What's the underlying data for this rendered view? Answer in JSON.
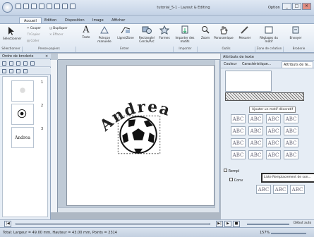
{
  "titlebar": {
    "title": "tutorial_5-1 - Layout & Editing",
    "option_label": "Option",
    "min": "_",
    "max": "□",
    "close": "×"
  },
  "tabs": [
    {
      "label": "Accueil"
    },
    {
      "label": "Edition"
    },
    {
      "label": "Disposition"
    },
    {
      "label": "Image"
    },
    {
      "label": "Afficher"
    }
  ],
  "ribbon": {
    "select": "Sélectionner",
    "clipboard": [
      "Couper",
      "Copier",
      "Coller",
      "Dupliquer",
      "Effacer"
    ],
    "texte": "Texte",
    "poincon": "Poinçon manuelle",
    "ligne": "Ligne/Zone",
    "rectangle": "Rectangle/ Cercle/Arc",
    "formes": "Formes",
    "importer": "Importer des motifs",
    "zoom": "Zoom",
    "panoramique": "Panoramique",
    "mesurer": "Mesurer",
    "reglages": "Réglages du motif",
    "envoyer": "Envoyer",
    "groups": [
      "Sélectionner",
      "Presse-papiers",
      "Entrer",
      "Importer",
      "Outils",
      "Zone de création",
      "Broderie"
    ]
  },
  "leftpanel": {
    "header": "Ordre de broderie",
    "items": [
      {
        "num": "1"
      },
      {
        "num": "2"
      },
      {
        "num": "3"
      }
    ],
    "thumb3_text": "Andrea"
  },
  "canvas": {
    "text": "Andrea"
  },
  "rightpanel": {
    "header": "Attributs de texte",
    "tabs": [
      "Couleur",
      "Caractéristique...",
      "Attributs de te..."
    ],
    "tooltip": "Ajouter un motif décoratif",
    "abc": "ABC",
    "remplissage_label": "Rempl",
    "conv_label": "Conv",
    "highlight_label": "Liste Remplacement de son..."
  },
  "playbar": {
    "buttons": [
      "|◀",
      "◀",
      "▶|",
      "▶",
      "■"
    ],
    "speed_label": "Début auto"
  },
  "status": {
    "text": "Total: Largeur = 49.00 mm, Hauteur = 43.00 mm, Points = 2314",
    "zoom": "157%"
  },
  "colors": {
    "accent": "#5b7fa9",
    "ribbon": "#dde6f1",
    "page": "#ffffff"
  }
}
